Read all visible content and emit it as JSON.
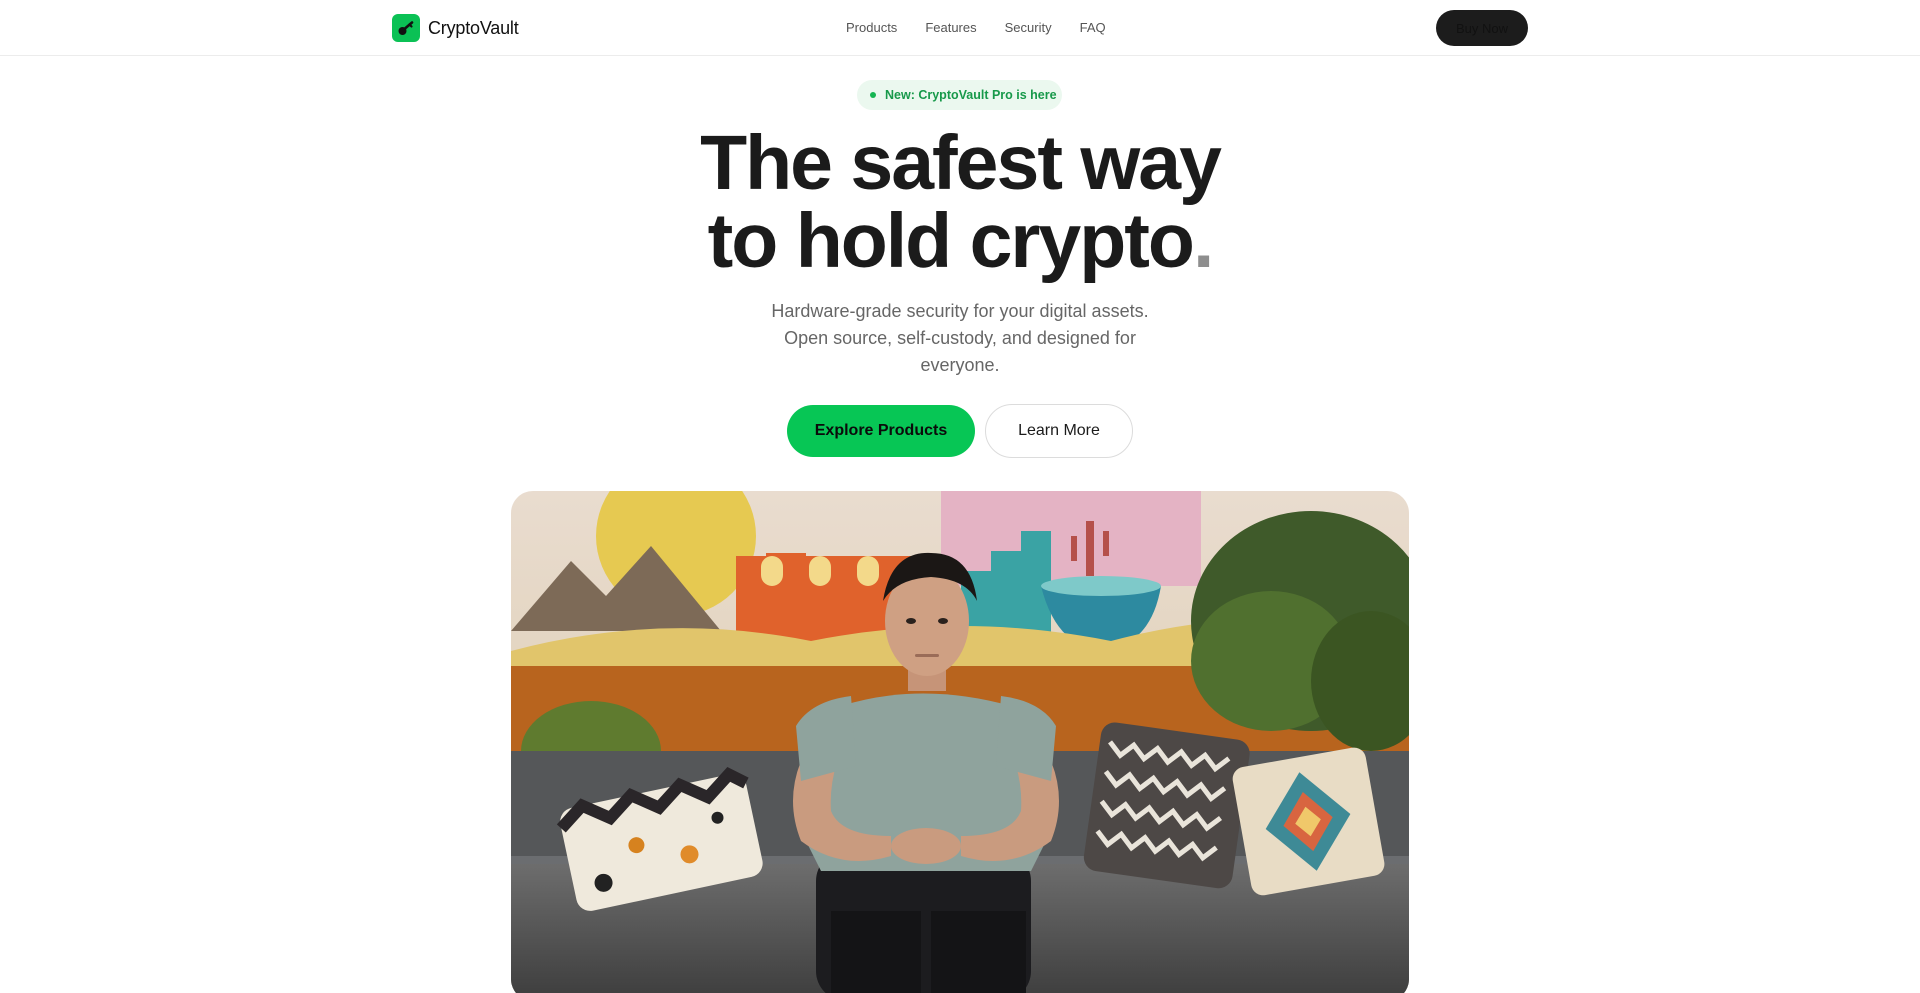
{
  "brand": {
    "name": "CryptoVault",
    "accent_color": "#07c655",
    "logo_icon": "key-icon"
  },
  "nav": {
    "items": [
      {
        "label": "Products"
      },
      {
        "label": "Features"
      },
      {
        "label": "Security"
      },
      {
        "label": "FAQ"
      }
    ],
    "buy_label": "Buy Now"
  },
  "hero": {
    "badge": "New: CryptoVault Pro is here",
    "headline_line1": "The safest way",
    "headline_line2": "to hold crypto",
    "headline_dot": ".",
    "subtext_lines": [
      "Hardware-grade security for your digital assets.",
      "Open source, self-custody, and designed for",
      "everyone."
    ],
    "primary_cta": "Explore Products",
    "secondary_cta": "Learn More",
    "image_subject": "person-seated-on-sofa-photo"
  }
}
